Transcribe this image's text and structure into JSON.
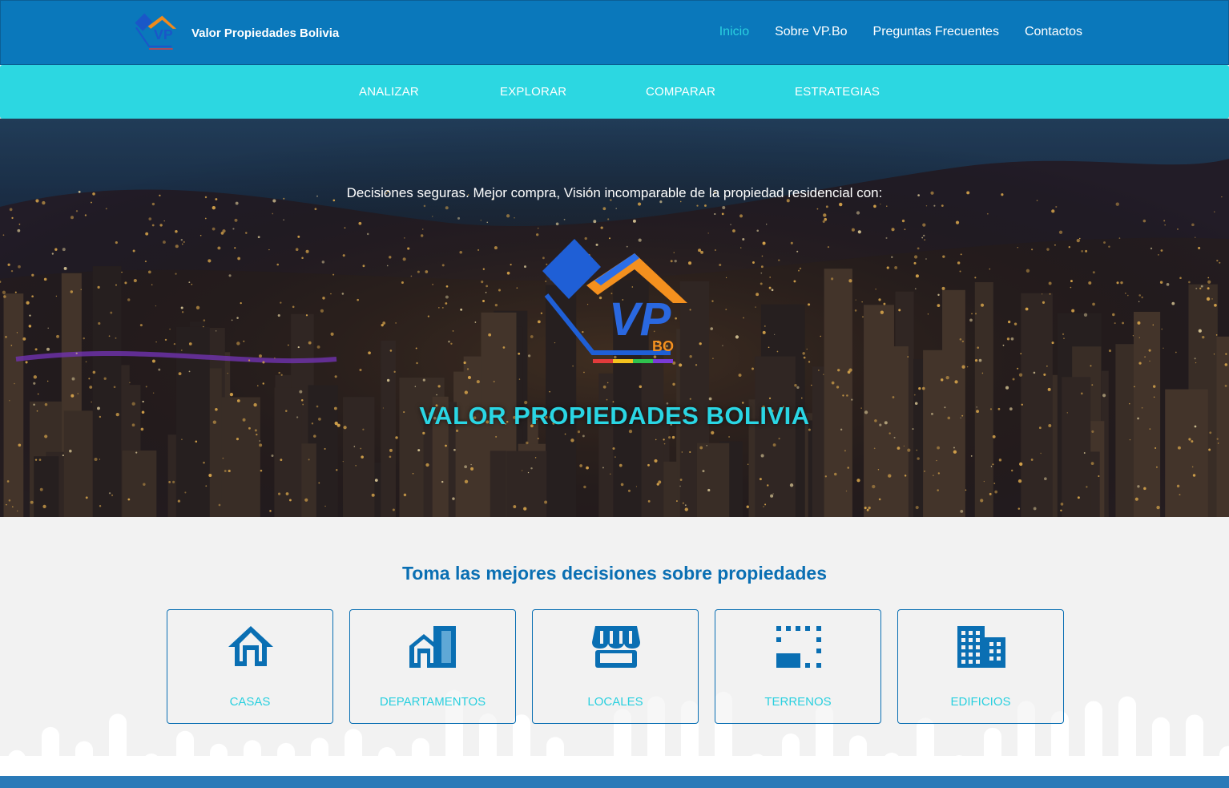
{
  "header": {
    "brand_name": "Valor Propiedades Bolivia",
    "nav": [
      {
        "label": "Inicio",
        "active": true
      },
      {
        "label": "Sobre VP.Bo",
        "active": false
      },
      {
        "label": "Preguntas Frecuentes",
        "active": false
      },
      {
        "label": "Contactos",
        "active": false
      }
    ]
  },
  "subnav": [
    "ANALIZAR",
    "EXPLORAR",
    "COMPARAR",
    "ESTRATEGIAS"
  ],
  "hero": {
    "tagline": "Decisiones seguras. Mejor compra, Visión incomparable de la propiedad residencial con:",
    "logo_text": "BO",
    "title": "VALOR PROPIEDADES BOLIVIA"
  },
  "categories": {
    "heading": "Toma las mejores decisiones sobre propiedades",
    "items": [
      {
        "label": "CASAS",
        "icon": "house-icon"
      },
      {
        "label": "DEPARTAMENTOS",
        "icon": "apartment-icon"
      },
      {
        "label": "LOCALES",
        "icon": "storefront-icon"
      },
      {
        "label": "TERRENOS",
        "icon": "land-plot-icon"
      },
      {
        "label": "EDIFICIOS",
        "icon": "building-icon"
      }
    ]
  },
  "colors": {
    "topbar": "#0a78bb",
    "subbar": "#2cd7e1",
    "accent": "#2ad0df",
    "primary_text": "#0a6fb3"
  }
}
